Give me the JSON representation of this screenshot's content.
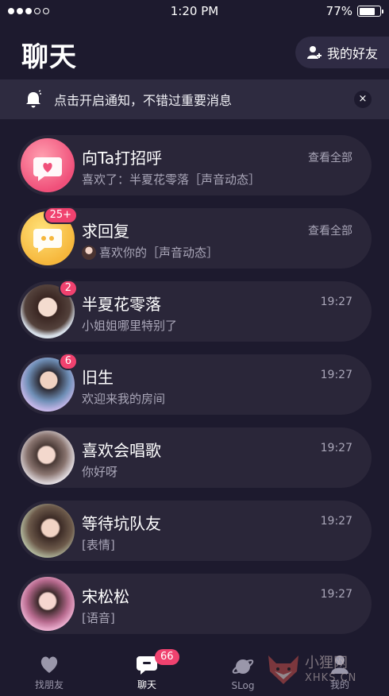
{
  "status_bar": {
    "time": "1:20 PM",
    "battery_label": "77%",
    "battery_level": 0.77
  },
  "header": {
    "title": "聊天",
    "friends_button_label": "我的好友"
  },
  "notice": {
    "text": "点击开启通知，不错过重要消息",
    "close_label": "×"
  },
  "chats": [
    {
      "name": "向Ta打招呼",
      "preview": "喜欢了：半夏花零落［声音动态］",
      "meta": "查看全部",
      "badge": "",
      "avatar_icon": "heart-bubble-icon"
    },
    {
      "name": "求回复",
      "preview": "喜欢你的［声音动态］",
      "meta": "查看全部",
      "badge": "25+",
      "avatar_icon": "chat-bubble-icon"
    },
    {
      "name": "半夏花零落",
      "preview": "小姐姐哪里特别了",
      "meta": "19:27",
      "badge": "2"
    },
    {
      "name": "旧生",
      "preview": "欢迎来我的房间",
      "meta": "19:27",
      "badge": "6"
    },
    {
      "name": "喜欢会唱歌",
      "preview": "你好呀",
      "meta": "19:27",
      "badge": ""
    },
    {
      "name": "等待坑队友",
      "preview": "[表情]",
      "meta": "19:27",
      "badge": ""
    },
    {
      "name": "宋松松",
      "preview": "[语音]",
      "meta": "19:27",
      "badge": ""
    }
  ],
  "tabs": [
    {
      "label": "找朋友",
      "icon": "heart-icon",
      "active": false
    },
    {
      "label": "聊天",
      "icon": "chat-icon",
      "active": true,
      "badge": "66"
    },
    {
      "label": "SLog",
      "icon": "planet-icon",
      "active": false
    },
    {
      "label": "我的",
      "icon": "profile-icon",
      "active": false
    }
  ],
  "watermark": {
    "text": "小狸网",
    "sub": "XHKS.CN"
  },
  "colors": {
    "background": "#1d1a2e",
    "card": "#2a2639",
    "badge": "#f0426f",
    "secondary_text": "#a9a6b8"
  }
}
